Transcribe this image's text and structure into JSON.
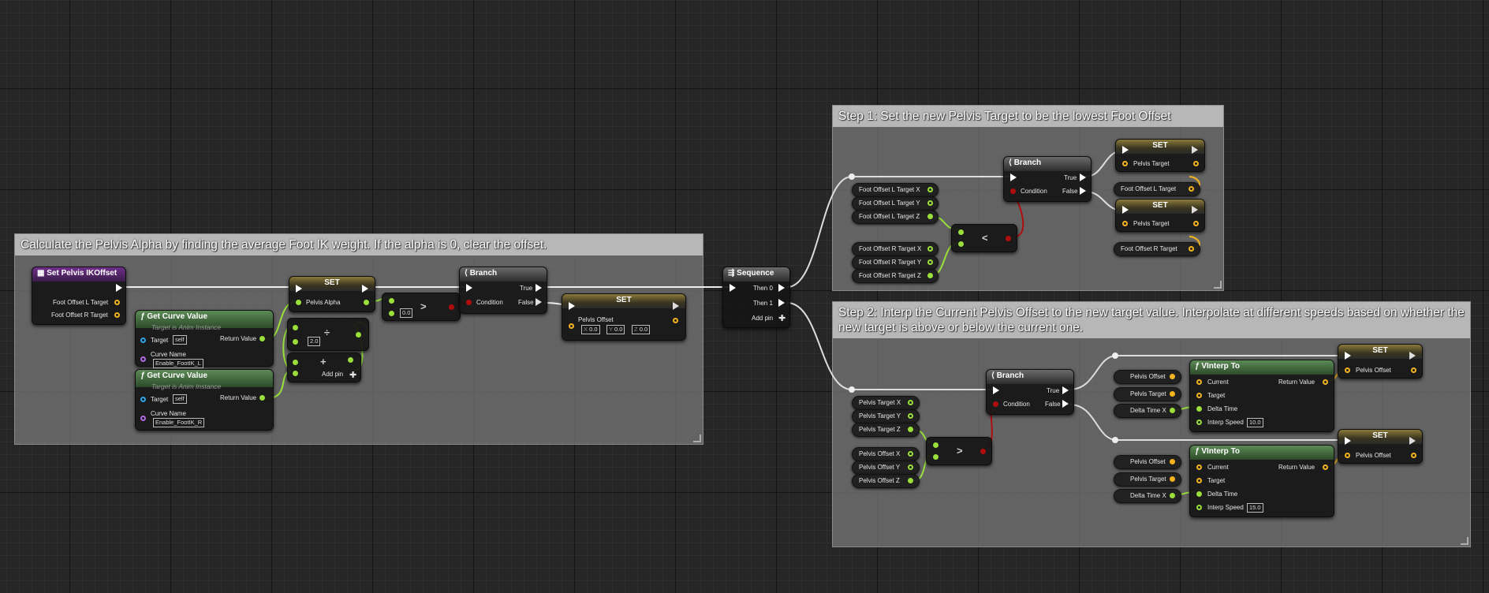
{
  "comments": {
    "pelvis_alpha": "Calculate the Pelvis Alpha by finding the average Foot IK weight. If the alpha is 0, clear the offset.",
    "step1": "Step 1: Set the new Pelvis Target to be the lowest Foot Offset",
    "step2": "Step 2: Interp the Current Pelvis Offset to the new target value. Interpolate at different speeds based on whether the new target is above or below the current one."
  },
  "func_node": {
    "title": "Set Pelvis IKOffset",
    "pin1": "Foot Offset L Target",
    "pin2": "Foot Offset R Target"
  },
  "curve_l": {
    "title": "Get Curve Value",
    "subtitle": "Target is Anim Instance",
    "target": "Target",
    "target_val": "self",
    "return": "Return Value",
    "curve_name": "Curve Name",
    "curve_val": "Enable_FootIK_L"
  },
  "curve_r": {
    "title": "Get Curve Value",
    "subtitle": "Target is Anim Instance",
    "target": "Target",
    "target_val": "self",
    "return": "Return Value",
    "curve_name": "Curve Name",
    "curve_val": "Enable_FootIK_R"
  },
  "divide": {
    "op": "÷",
    "val": "2.0"
  },
  "add": {
    "op": "+",
    "add_pin": "Add pin"
  },
  "set_alpha": {
    "title": "SET",
    "pin": "Pelvis Alpha"
  },
  "greater1": {
    "op": ">",
    "val": "0.0"
  },
  "branch1": {
    "title": "Branch",
    "cond": "Condition",
    "true": "True",
    "false": "False"
  },
  "set_offset": {
    "title": "SET",
    "pin": "Pelvis Offset",
    "x": "0.0",
    "y": "0.0",
    "z": "0.0",
    "xl": "X",
    "yl": "Y",
    "zl": "Z"
  },
  "sequence": {
    "title": "Sequence",
    "then0": "Then 0",
    "then1": "Then 1",
    "add_pin": "Add pin"
  },
  "step1": {
    "vars_l": [
      "Foot Offset L Target X",
      "Foot Offset L Target Y",
      "Foot Offset L Target Z"
    ],
    "vars_r": [
      "Foot Offset R Target X",
      "Foot Offset R Target Y",
      "Foot Offset R Target Z"
    ],
    "less": "<",
    "branch": {
      "title": "Branch",
      "cond": "Condition",
      "true": "True",
      "false": "False"
    },
    "set1": {
      "title": "SET",
      "pin": "Pelvis Target"
    },
    "set1_src": "Foot Offset L Target",
    "set2": {
      "title": "SET",
      "pin": "Pelvis Target"
    },
    "set2_src": "Foot Offset R Target"
  },
  "step2": {
    "vars_t": [
      "Pelvis Target X",
      "Pelvis Target Y",
      "Pelvis Target Z"
    ],
    "vars_o": [
      "Pelvis Offset X",
      "Pelvis Offset Y",
      "Pelvis Offset Z"
    ],
    "greater": ">",
    "branch": {
      "title": "Branch",
      "cond": "Condition",
      "true": "True",
      "false": "False"
    },
    "interp1": {
      "title": "VInterp To",
      "current": "Current",
      "target": "Target",
      "delta": "Delta Time",
      "speed": "Interp Speed",
      "speed_val": "10.0",
      "return": "Return Value"
    },
    "interp2": {
      "title": "VInterp To",
      "current": "Current",
      "target": "Target",
      "delta": "Delta Time",
      "speed": "Interp Speed",
      "speed_val": "15.0",
      "return": "Return Value"
    },
    "in_vars": [
      "Pelvis Offset",
      "Pelvis Target",
      "Delta Time X"
    ],
    "set": {
      "title": "SET",
      "pin": "Pelvis Offset"
    }
  },
  "colors": {
    "exec": "#ffffff",
    "float": "#9adf3b",
    "vector": "#f3b41f",
    "bool": "#b00d0d"
  }
}
